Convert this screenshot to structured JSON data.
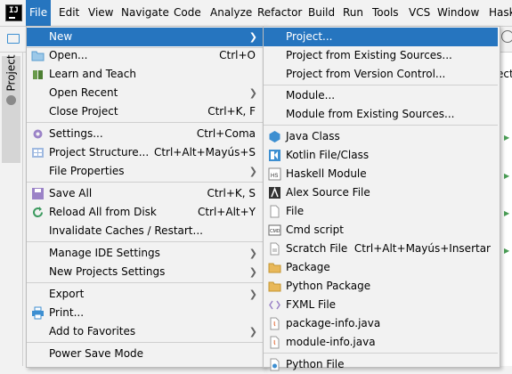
{
  "menubar": {
    "logo_text": "IJ",
    "items": [
      "File",
      "Edit",
      "View",
      "Navigate",
      "Code",
      "Analyze",
      "Refactor",
      "Build",
      "Run",
      "Tools",
      "VCS",
      "Window",
      "Hask"
    ]
  },
  "toolwindow": {
    "project_label": "Project"
  },
  "editor": {
    "right_fragment": "ect"
  },
  "file_menu": {
    "items": [
      {
        "label": "New",
        "shortcut": ""
      },
      {
        "label": "Open...",
        "shortcut": "Ctrl+O"
      },
      {
        "label": "Learn and Teach",
        "shortcut": ""
      },
      {
        "label": "Open Recent",
        "shortcut": ""
      },
      {
        "label": "Close Project",
        "shortcut": "Ctrl+K, F"
      },
      {
        "label": "Settings...",
        "shortcut": "Ctrl+Coma"
      },
      {
        "label": "Project Structure...",
        "shortcut": "Ctrl+Alt+Mayús+S"
      },
      {
        "label": "File Properties",
        "shortcut": ""
      },
      {
        "label": "Save All",
        "shortcut": "Ctrl+K, S"
      },
      {
        "label": "Reload All from Disk",
        "shortcut": "Ctrl+Alt+Y"
      },
      {
        "label": "Invalidate Caches / Restart...",
        "shortcut": ""
      },
      {
        "label": "Manage IDE Settings",
        "shortcut": ""
      },
      {
        "label": "New Projects Settings",
        "shortcut": ""
      },
      {
        "label": "Export",
        "shortcut": ""
      },
      {
        "label": "Print...",
        "shortcut": ""
      },
      {
        "label": "Add to Favorites",
        "shortcut": ""
      },
      {
        "label": "Power Save Mode",
        "shortcut": ""
      }
    ]
  },
  "new_submenu": {
    "items": [
      {
        "label": "Project...",
        "shortcut": ""
      },
      {
        "label": "Project from Existing Sources...",
        "shortcut": ""
      },
      {
        "label": "Project from Version Control...",
        "shortcut": ""
      },
      {
        "label": "Module...",
        "shortcut": ""
      },
      {
        "label": "Module from Existing Sources...",
        "shortcut": ""
      },
      {
        "label": "Java Class",
        "shortcut": ""
      },
      {
        "label": "Kotlin File/Class",
        "shortcut": ""
      },
      {
        "label": "Haskell Module",
        "shortcut": ""
      },
      {
        "label": "Alex Source File",
        "shortcut": ""
      },
      {
        "label": "File",
        "shortcut": ""
      },
      {
        "label": "Cmd script",
        "shortcut": ""
      },
      {
        "label": "Scratch File",
        "shortcut": "Ctrl+Alt+Mayús+Insertar"
      },
      {
        "label": "Package",
        "shortcut": ""
      },
      {
        "label": "Python Package",
        "shortcut": ""
      },
      {
        "label": "FXML File",
        "shortcut": ""
      },
      {
        "label": "package-info.java",
        "shortcut": ""
      },
      {
        "label": "module-info.java",
        "shortcut": ""
      },
      {
        "label": "Python File",
        "shortcut": ""
      }
    ]
  },
  "colors": {
    "selection": "#2675bf",
    "menu_bg": "#f2f2f2",
    "separator": "#cfcfcf"
  }
}
